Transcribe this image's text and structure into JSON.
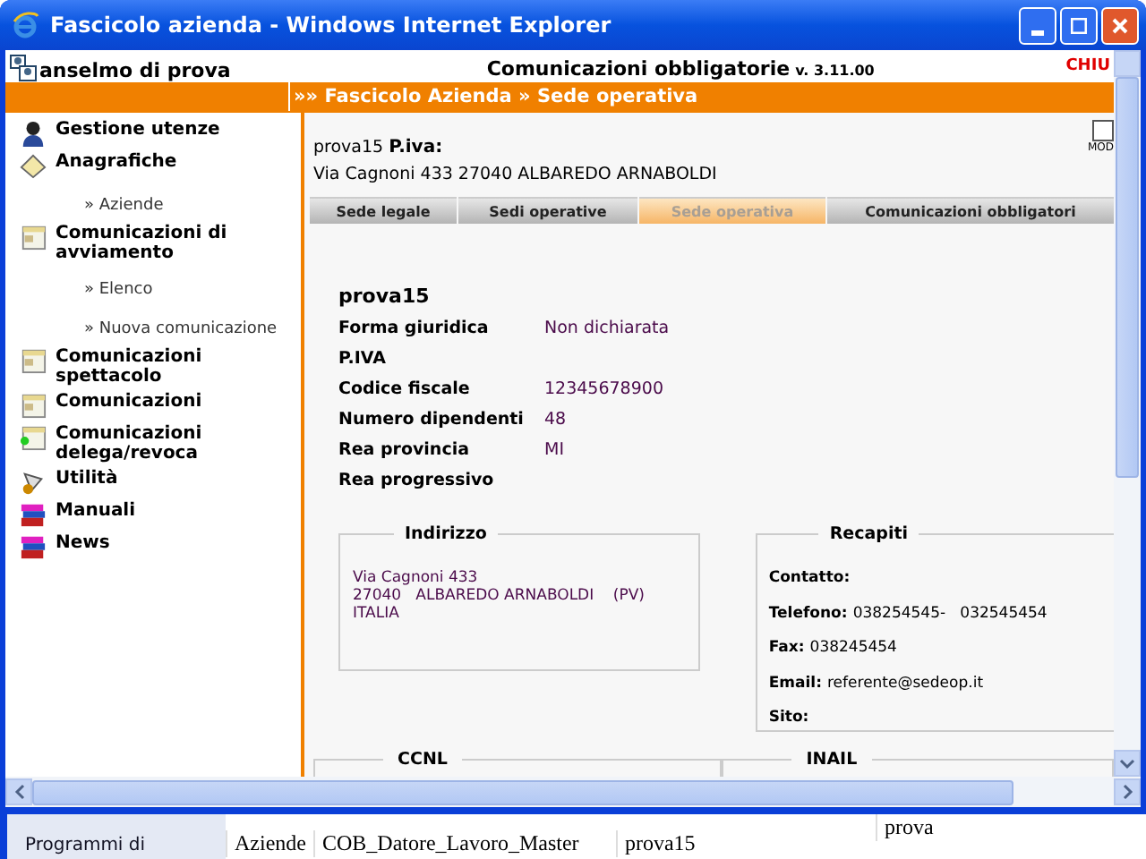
{
  "window": {
    "title": "Fascicolo azienda - Windows Internet Explorer"
  },
  "header": {
    "user": "anselmo di prova",
    "app_title": "Comunicazioni obbligatorie",
    "version": "v. 3.11.00",
    "right_link": "CHIU"
  },
  "breadcrumb": "»» Fascicolo Azienda » Sede operativa",
  "sidebar": {
    "items": [
      {
        "label": "Gestione utenze"
      },
      {
        "label": "Anagrafiche",
        "children": [
          {
            "label": "» Aziende"
          }
        ]
      },
      {
        "label": "Comunicazioni di avviamento",
        "children": [
          {
            "label": "» Elenco"
          },
          {
            "label": "» Nuova comunicazione"
          }
        ]
      },
      {
        "label": "Comunicazioni spettacolo"
      },
      {
        "label": "Comunicazioni"
      },
      {
        "label": "Comunicazioni delega/revoca"
      },
      {
        "label": "Utilità"
      },
      {
        "label": "Manuali"
      },
      {
        "label": "News"
      }
    ]
  },
  "company": {
    "name": "prova15",
    "piva_label": "P.iva:",
    "address": "Via Cagnoni 433 27040 ALBAREDO ARNABOLDI",
    "modify_label": "MOD"
  },
  "tabs": [
    {
      "label": "Sede legale",
      "selected": false
    },
    {
      "label": "Sedi operative",
      "selected": false
    },
    {
      "label": "Sede operativa",
      "selected": true
    },
    {
      "label": "Comunicazioni obbligatori",
      "selected": false
    }
  ],
  "details": {
    "title": "prova15",
    "rows": [
      {
        "label": "Forma giuridica",
        "value": "Non dichiarata"
      },
      {
        "label": "P.IVA"
      },
      {
        "label": "Codice fiscale",
        "value": "12345678900"
      },
      {
        "label": "Numero dipendenti",
        "value": "48"
      },
      {
        "label": "Rea provincia",
        "value": "MI"
      },
      {
        "label": "Rea progressivo"
      }
    ]
  },
  "indirizzo": {
    "title": "Indirizzo",
    "lines": [
      "Via Cagnoni 433",
      "27040   ALBAREDO ARNABOLDI    (PV)",
      "ITALIA"
    ]
  },
  "recapiti": {
    "title": "Recapiti",
    "rows": [
      {
        "label": "Contatto:"
      },
      {
        "label": "Telefono:",
        "value": "038254545-   032545454"
      },
      {
        "label": "Fax:",
        "value": "038245454"
      },
      {
        "label": "Email:",
        "value": "referente@sedeop.it"
      },
      {
        "label": "Sito:"
      }
    ]
  },
  "bottom_sections": [
    "CCNL",
    "INAIL"
  ],
  "background_window": {
    "sidebar_item": "Programmi di",
    "row": [
      "Aziende",
      "COB_Datore_Lavoro_Master",
      "prova15",
      "prova"
    ]
  }
}
